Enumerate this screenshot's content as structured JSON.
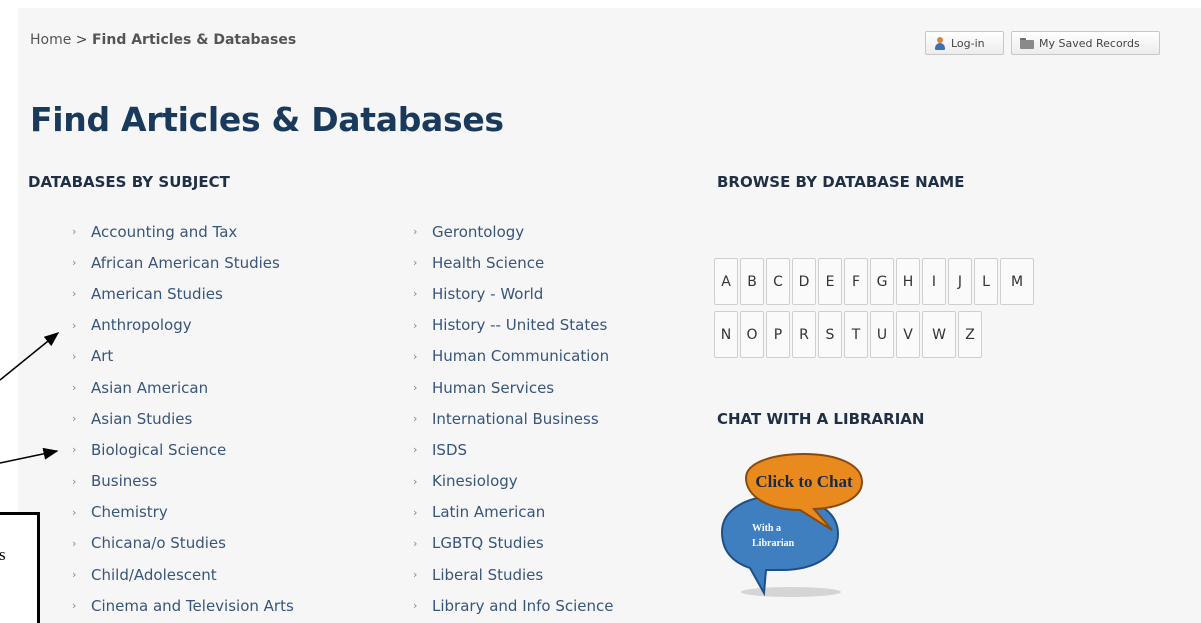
{
  "breadcrumb": {
    "home": "Home",
    "separator": ">",
    "current": "Find Articles & Databases"
  },
  "header_buttons": {
    "login": "Log-in",
    "saved": "My Saved Records"
  },
  "page_title": "Find Articles & Databases",
  "subjects": {
    "heading": "DATABASES BY SUBJECT",
    "chevron": "›",
    "column1": [
      "Accounting and Tax",
      "African American Studies",
      "American Studies",
      "Anthropology",
      "Art",
      "Asian American",
      "Asian Studies",
      "Biological Science",
      "Business",
      "Chemistry",
      "Chicana/o Studies",
      "Child/Adolescent",
      "Cinema and Television Arts"
    ],
    "column2": [
      "Gerontology",
      "Health Science",
      "History - World",
      "History -- United States",
      "Human Communication",
      "Human Services",
      "International Business",
      "ISDS",
      "Kinesiology",
      "Latin American",
      "LGBTQ Studies",
      "Liberal Studies",
      "Library and Info Science"
    ]
  },
  "browse": {
    "heading": "BROWSE BY DATABASE NAME",
    "row1": [
      "A",
      "B",
      "C",
      "D",
      "E",
      "F",
      "G",
      "H",
      "I",
      "J",
      "L",
      "M"
    ],
    "row2": [
      "N",
      "O",
      "P",
      "R",
      "S",
      "T",
      "U",
      "V",
      "W",
      "Z"
    ]
  },
  "chat": {
    "heading": "CHAT WITH A LIBRARIAN",
    "bubble_text": "Click to Chat",
    "sub_line1": "With a",
    "sub_line2": "Librarian",
    "colors": {
      "orange": "#e88a1e",
      "blue": "#3f7fc0"
    }
  },
  "annotation": {
    "callout_text": "s"
  },
  "colors": {
    "title": "#1a3a5c",
    "link": "#38557a",
    "panel_bg": "#f6f6f6"
  }
}
